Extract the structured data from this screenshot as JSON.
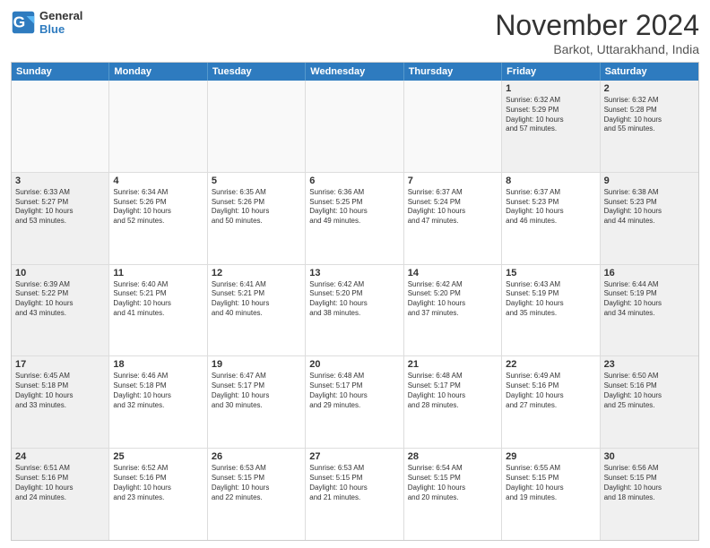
{
  "logo": {
    "line1": "General",
    "line2": "Blue"
  },
  "title": "November 2024",
  "location": "Barkot, Uttarakhand, India",
  "days_of_week": [
    "Sunday",
    "Monday",
    "Tuesday",
    "Wednesday",
    "Thursday",
    "Friday",
    "Saturday"
  ],
  "weeks": [
    [
      {
        "day": "",
        "text": ""
      },
      {
        "day": "",
        "text": ""
      },
      {
        "day": "",
        "text": ""
      },
      {
        "day": "",
        "text": ""
      },
      {
        "day": "",
        "text": ""
      },
      {
        "day": "1",
        "text": "Sunrise: 6:32 AM\nSunset: 5:29 PM\nDaylight: 10 hours\nand 57 minutes."
      },
      {
        "day": "2",
        "text": "Sunrise: 6:32 AM\nSunset: 5:28 PM\nDaylight: 10 hours\nand 55 minutes."
      }
    ],
    [
      {
        "day": "3",
        "text": "Sunrise: 6:33 AM\nSunset: 5:27 PM\nDaylight: 10 hours\nand 53 minutes."
      },
      {
        "day": "4",
        "text": "Sunrise: 6:34 AM\nSunset: 5:26 PM\nDaylight: 10 hours\nand 52 minutes."
      },
      {
        "day": "5",
        "text": "Sunrise: 6:35 AM\nSunset: 5:26 PM\nDaylight: 10 hours\nand 50 minutes."
      },
      {
        "day": "6",
        "text": "Sunrise: 6:36 AM\nSunset: 5:25 PM\nDaylight: 10 hours\nand 49 minutes."
      },
      {
        "day": "7",
        "text": "Sunrise: 6:37 AM\nSunset: 5:24 PM\nDaylight: 10 hours\nand 47 minutes."
      },
      {
        "day": "8",
        "text": "Sunrise: 6:37 AM\nSunset: 5:23 PM\nDaylight: 10 hours\nand 46 minutes."
      },
      {
        "day": "9",
        "text": "Sunrise: 6:38 AM\nSunset: 5:23 PM\nDaylight: 10 hours\nand 44 minutes."
      }
    ],
    [
      {
        "day": "10",
        "text": "Sunrise: 6:39 AM\nSunset: 5:22 PM\nDaylight: 10 hours\nand 43 minutes."
      },
      {
        "day": "11",
        "text": "Sunrise: 6:40 AM\nSunset: 5:21 PM\nDaylight: 10 hours\nand 41 minutes."
      },
      {
        "day": "12",
        "text": "Sunrise: 6:41 AM\nSunset: 5:21 PM\nDaylight: 10 hours\nand 40 minutes."
      },
      {
        "day": "13",
        "text": "Sunrise: 6:42 AM\nSunset: 5:20 PM\nDaylight: 10 hours\nand 38 minutes."
      },
      {
        "day": "14",
        "text": "Sunrise: 6:42 AM\nSunset: 5:20 PM\nDaylight: 10 hours\nand 37 minutes."
      },
      {
        "day": "15",
        "text": "Sunrise: 6:43 AM\nSunset: 5:19 PM\nDaylight: 10 hours\nand 35 minutes."
      },
      {
        "day": "16",
        "text": "Sunrise: 6:44 AM\nSunset: 5:19 PM\nDaylight: 10 hours\nand 34 minutes."
      }
    ],
    [
      {
        "day": "17",
        "text": "Sunrise: 6:45 AM\nSunset: 5:18 PM\nDaylight: 10 hours\nand 33 minutes."
      },
      {
        "day": "18",
        "text": "Sunrise: 6:46 AM\nSunset: 5:18 PM\nDaylight: 10 hours\nand 32 minutes."
      },
      {
        "day": "19",
        "text": "Sunrise: 6:47 AM\nSunset: 5:17 PM\nDaylight: 10 hours\nand 30 minutes."
      },
      {
        "day": "20",
        "text": "Sunrise: 6:48 AM\nSunset: 5:17 PM\nDaylight: 10 hours\nand 29 minutes."
      },
      {
        "day": "21",
        "text": "Sunrise: 6:48 AM\nSunset: 5:17 PM\nDaylight: 10 hours\nand 28 minutes."
      },
      {
        "day": "22",
        "text": "Sunrise: 6:49 AM\nSunset: 5:16 PM\nDaylight: 10 hours\nand 27 minutes."
      },
      {
        "day": "23",
        "text": "Sunrise: 6:50 AM\nSunset: 5:16 PM\nDaylight: 10 hours\nand 25 minutes."
      }
    ],
    [
      {
        "day": "24",
        "text": "Sunrise: 6:51 AM\nSunset: 5:16 PM\nDaylight: 10 hours\nand 24 minutes."
      },
      {
        "day": "25",
        "text": "Sunrise: 6:52 AM\nSunset: 5:16 PM\nDaylight: 10 hours\nand 23 minutes."
      },
      {
        "day": "26",
        "text": "Sunrise: 6:53 AM\nSunset: 5:15 PM\nDaylight: 10 hours\nand 22 minutes."
      },
      {
        "day": "27",
        "text": "Sunrise: 6:53 AM\nSunset: 5:15 PM\nDaylight: 10 hours\nand 21 minutes."
      },
      {
        "day": "28",
        "text": "Sunrise: 6:54 AM\nSunset: 5:15 PM\nDaylight: 10 hours\nand 20 minutes."
      },
      {
        "day": "29",
        "text": "Sunrise: 6:55 AM\nSunset: 5:15 PM\nDaylight: 10 hours\nand 19 minutes."
      },
      {
        "day": "30",
        "text": "Sunrise: 6:56 AM\nSunset: 5:15 PM\nDaylight: 10 hours\nand 18 minutes."
      }
    ]
  ]
}
